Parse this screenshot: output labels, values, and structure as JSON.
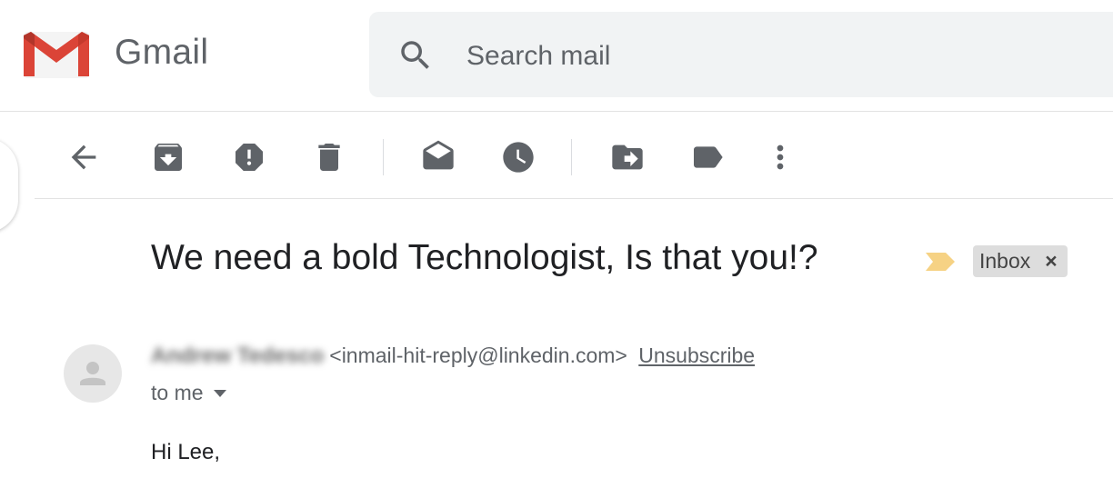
{
  "app": {
    "title": "Gmail",
    "logo": "gmail-m-logo",
    "brand_colors": {
      "red": "#db4437",
      "dark_red": "#b2352a",
      "envelope": "#f5f5f5"
    }
  },
  "search": {
    "placeholder": "Search mail",
    "icon": "search-icon"
  },
  "toolbar": {
    "buttons": [
      {
        "name": "back",
        "icon": "arrow-back-icon"
      },
      {
        "name": "archive",
        "icon": "archive-icon"
      },
      {
        "name": "report-spam",
        "icon": "report-spam-icon"
      },
      {
        "name": "delete",
        "icon": "delete-icon"
      },
      {
        "name": "mark-unread",
        "icon": "mark-unread-icon"
      },
      {
        "name": "snooze",
        "icon": "snooze-clock-icon"
      },
      {
        "name": "move-to",
        "icon": "move-to-icon"
      },
      {
        "name": "labels",
        "icon": "label-icon"
      },
      {
        "name": "more",
        "icon": "more-vert-icon"
      }
    ],
    "icon_color": "#5f6368"
  },
  "message": {
    "subject": "We need a bold Technologist, Is that you!?",
    "importance_marker": "importance-marker-icon",
    "importance_color": "#f6d284",
    "label": {
      "text": "Inbox",
      "remove_glyph": "×"
    },
    "sender": {
      "name": "Andrew Tedesco",
      "email": "<inmail-hit-reply@linkedin.com>",
      "unsubscribe": "Unsubscribe"
    },
    "recipient": "to me",
    "body": "Hi Lee,"
  }
}
